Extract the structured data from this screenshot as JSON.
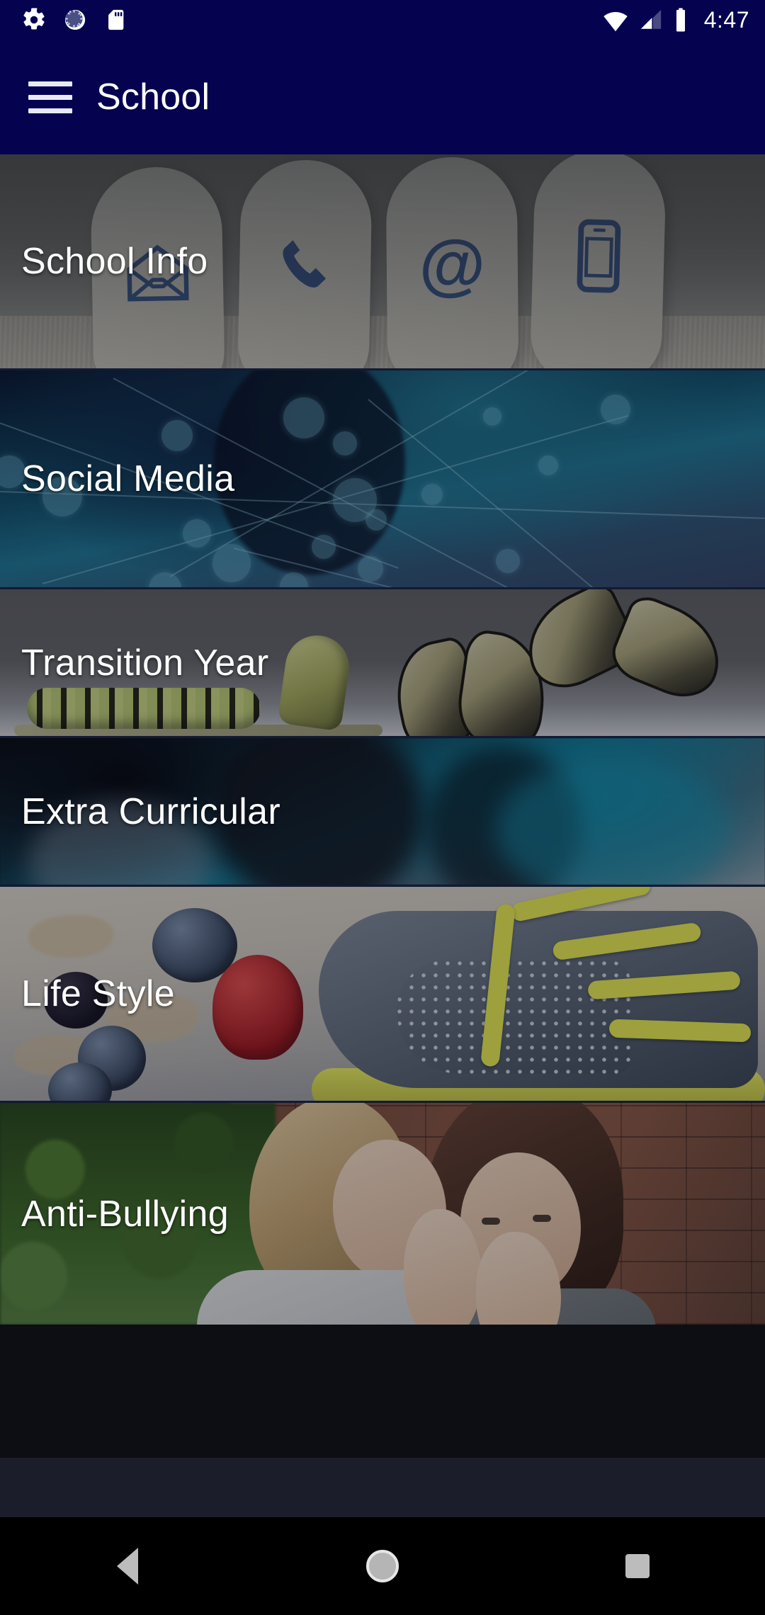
{
  "status_bar": {
    "icons_left": [
      "settings-gear-icon",
      "sync-progress-icon",
      "sd-card-icon"
    ],
    "icons_right": [
      "wifi-icon",
      "cellular-signal-icon",
      "battery-full-icon"
    ],
    "time": "4:47"
  },
  "app_bar": {
    "menu_icon": "hamburger-menu-icon",
    "title": "School",
    "background_color": "#050250"
  },
  "cards": [
    {
      "id": "school-info",
      "label": "School Info",
      "artwork": "white rounded tiles showing blue contact icons: envelope, telephone handset, at-sign, mobile phone, resting on newspaper"
    },
    {
      "id": "social-media",
      "label": "Social Media",
      "artwork": "teal and dark-blue abstract network of connected nodes and lines"
    },
    {
      "id": "transition-year",
      "label": "Transition Year",
      "artwork": "butterfly metamorphosis: caterpillar, chrysalis and swallowtail butterfly on grey background"
    },
    {
      "id": "extra-curricular",
      "label": "Extra Curricular",
      "artwork": "teal-tinted motion-blurred photo of a runner in action"
    },
    {
      "id": "life-style",
      "label": "Life Style",
      "artwork": "grey running shoe with yellow laces beside raspberry, blueberries and cereal"
    },
    {
      "id": "anti-bullying",
      "label": "Anti-Bullying",
      "artwork": "two girls whispering in front of a brick wall with green foliage"
    }
  ],
  "nav_bar": {
    "back": "back-triangle-icon",
    "home": "home-circle-icon",
    "recents": "recents-square-icon"
  },
  "colors": {
    "app_bar": "#050250",
    "filler_strip": "#1b1d2a",
    "nav_bar": "#000000",
    "card_label": "#ffffff"
  }
}
